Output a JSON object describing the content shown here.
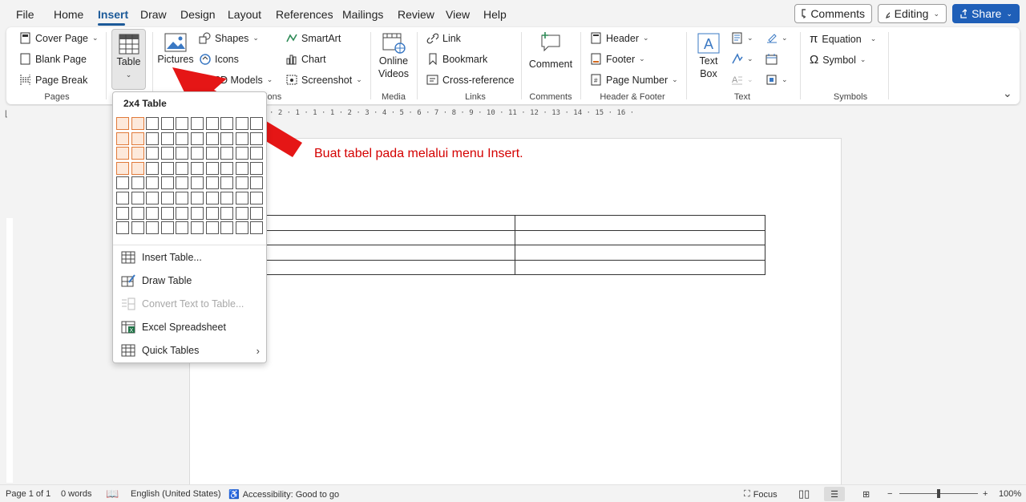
{
  "menu": {
    "tabs": [
      "File",
      "Home",
      "Insert",
      "Draw",
      "Design",
      "Layout",
      "References",
      "Mailings",
      "Review",
      "View",
      "Help"
    ],
    "active_tab": "Insert",
    "comments_label": "Comments",
    "editing_label": "Editing",
    "share_label": "Share"
  },
  "ribbon": {
    "pages": {
      "cover_page": "Cover Page",
      "blank_page": "Blank Page",
      "page_break": "Page Break",
      "label": "Pages"
    },
    "tables": {
      "table": "Table"
    },
    "illustrations": {
      "pictures": "Pictures",
      "shapes": "Shapes",
      "icons": "Icons",
      "models": "3D Models",
      "smartart": "SmartArt",
      "chart": "Chart",
      "screenshot": "Screenshot",
      "label_partial": "tions"
    },
    "media": {
      "online_videos_1": "Online",
      "online_videos_2": "Videos",
      "label": "Media"
    },
    "links": {
      "link": "Link",
      "bookmark": "Bookmark",
      "cross_reference": "Cross-reference",
      "label": "Links"
    },
    "comments": {
      "comment": "Comment",
      "label": "Comments"
    },
    "header_footer": {
      "header": "Header",
      "footer": "Footer",
      "page_number": "Page Number",
      "label": "Header & Footer"
    },
    "text": {
      "text_box_1": "Text",
      "text_box_2": "Box",
      "label": "Text"
    },
    "symbols": {
      "equation": "Equation",
      "symbol": "Symbol",
      "label": "Symbols"
    }
  },
  "ruler": {
    "ticks": "· 2 · 1 · 1 · 1 · 2 · 3 · 4 · 5 · 6 · 7 · 8 · 9 · 10 · 11 · 12 · 13 · 14 · 15 · 16 ·"
  },
  "dropdown": {
    "title": "2x4 Table",
    "grid": {
      "cols": 10,
      "rows": 8,
      "selected_cols": 2,
      "selected_rows": 4
    },
    "items": [
      {
        "label": "Insert Table...",
        "enabled": true
      },
      {
        "label": "Draw Table",
        "enabled": true
      },
      {
        "label": "Convert Text to Table...",
        "enabled": false
      },
      {
        "label": "Excel Spreadsheet",
        "enabled": true
      },
      {
        "label": "Quick Tables",
        "enabled": true
      }
    ]
  },
  "annotation": "Buat tabel pada melalui menu Insert.",
  "document": {
    "table_rows": 4,
    "table_cols": 2
  },
  "statusbar": {
    "page": "Page 1 of 1",
    "words": "0 words",
    "language": "English (United States)",
    "accessibility": "Accessibility: Good to go",
    "focus": "Focus",
    "zoom": "100%"
  },
  "colors": {
    "accent": "#1c5a99",
    "share": "#1f5fb8",
    "arrow": "#e51616",
    "annotation": "#d40000",
    "grid_select": "#e07a3a"
  }
}
